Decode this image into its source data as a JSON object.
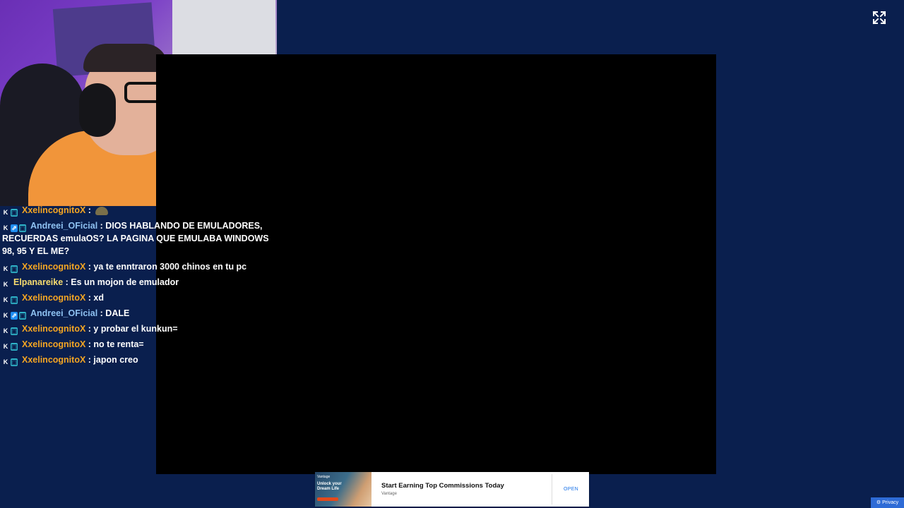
{
  "colors": {
    "background": "#0a1f4e",
    "video": "#000000",
    "username_orange": "#f5a623",
    "username_blue": "#8ec1f1",
    "kick_green": "#53fc18"
  },
  "chat": {
    "messages": [
      {
        "user": "XxelincognitoX",
        "user_color": "#f5a623",
        "badges": [
          "kick",
          "sub"
        ],
        "text": "",
        "emote": "turtle-emote"
      },
      {
        "user": "Andreei_OFicial",
        "user_color": "#8ec1f1",
        "badges": [
          "kick",
          "vip",
          "sub"
        ],
        "text": "DIOS HABLANDO DE EMULADORES, RECUERDAS emulaOS? LA PAGINA QUE EMULABA WINDOWS 98, 95 Y EL ME?"
      },
      {
        "user": "XxelincognitoX",
        "user_color": "#f5a623",
        "badges": [
          "kick",
          "sub"
        ],
        "text": "ya te enntraron 3000 chinos en tu pc"
      },
      {
        "user": "Elpanareike",
        "user_color": "#f7dc6f",
        "badges": [
          "kick"
        ],
        "text": "Es un mojon de emulador"
      },
      {
        "user": "XxelincognitoX",
        "user_color": "#f5a623",
        "badges": [
          "kick",
          "sub"
        ],
        "text": "xd"
      },
      {
        "user": "Andreei_OFicial",
        "user_color": "#8ec1f1",
        "badges": [
          "kick",
          "vip",
          "sub"
        ],
        "text": "DALE"
      },
      {
        "user": "XxelincognitoX",
        "user_color": "#f5a623",
        "badges": [
          "kick",
          "sub"
        ],
        "text": "y probar el kunkun="
      },
      {
        "user": "XxelincognitoX",
        "user_color": "#f5a623",
        "badges": [
          "kick",
          "sub"
        ],
        "text": "no te renta="
      },
      {
        "user": "XxelincognitoX",
        "user_color": "#f5a623",
        "badges": [
          "kick",
          "sub"
        ],
        "text": "japon creo"
      }
    ]
  },
  "ad": {
    "thumb_brand": "Vantage",
    "thumb_text": "Unlock your Dream Life",
    "title": "Start Earning Top Commissions Today",
    "advertiser": "Vantage",
    "cta": "OPEN"
  },
  "privacy": {
    "label": "Privacy"
  },
  "icons": {
    "expand": "fullscreen-expand-icon",
    "privacy": "privacy-gear-icon"
  }
}
